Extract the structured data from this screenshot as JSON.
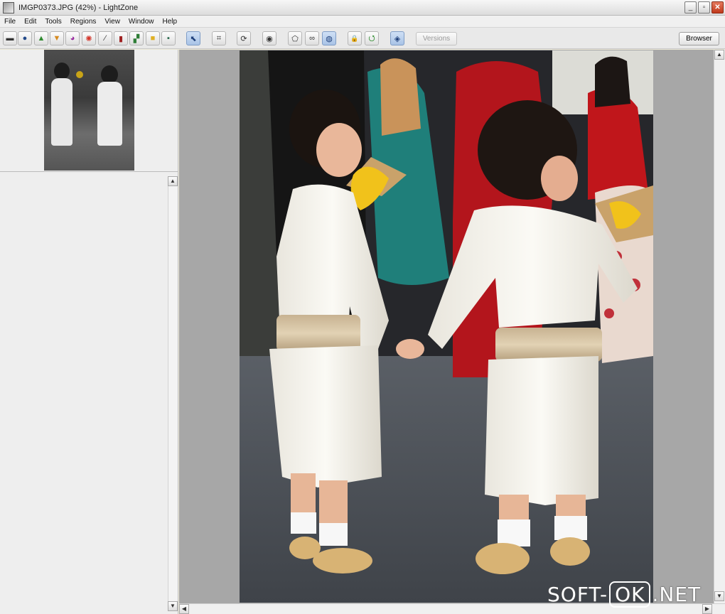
{
  "window": {
    "title": "IMGP0373.JPG (42%) - LightZone",
    "minimize_label": "_",
    "maximize_label": "▫",
    "close_label": "✕"
  },
  "menu": {
    "items": [
      "File",
      "Edit",
      "Tools",
      "Regions",
      "View",
      "Window",
      "Help"
    ]
  },
  "toolbar": {
    "versions_label": "Versions",
    "browser_label": "Browser",
    "tools": [
      {
        "icon": "zone-mapper-icon",
        "glyph": "▬"
      },
      {
        "icon": "tone-curve-icon",
        "glyph": "●"
      },
      {
        "icon": "sharpen-icon",
        "glyph": "▲"
      },
      {
        "icon": "noise-reduction-icon",
        "glyph": "▼"
      },
      {
        "icon": "color-balance-icon",
        "glyph": "◕"
      },
      {
        "icon": "hue-saturation-icon",
        "glyph": "✺"
      },
      {
        "icon": "white-balance-icon",
        "glyph": "⁄"
      },
      {
        "icon": "clone-icon",
        "glyph": "▮"
      },
      {
        "icon": "relight-icon",
        "glyph": "▞"
      },
      {
        "icon": "black-white-icon",
        "glyph": "■"
      },
      {
        "icon": "filter-icon",
        "glyph": "▪"
      },
      {
        "icon": "select-icon",
        "glyph": "⬉"
      },
      {
        "icon": "crop-icon",
        "glyph": "⌗"
      },
      {
        "icon": "rotate-icon",
        "glyph": "⟳"
      },
      {
        "icon": "eye-icon",
        "glyph": "◉"
      },
      {
        "icon": "polygon-region-icon",
        "glyph": "⬠"
      },
      {
        "icon": "bezier-region-icon",
        "glyph": "∞"
      },
      {
        "icon": "spline-region-icon",
        "glyph": "◍"
      },
      {
        "icon": "lock-icon",
        "glyph": "🔒"
      },
      {
        "icon": "undo-icon",
        "glyph": "⭯"
      },
      {
        "icon": "drop-icon",
        "glyph": "◈"
      }
    ]
  },
  "watermark": {
    "left": "SOFT-",
    "ok": "OK",
    "right": ".NET"
  },
  "colors": {
    "canvas_bg": "#a7a7a7",
    "panel_bg": "#eeeeee",
    "active_tool": "#a9c3e6"
  }
}
